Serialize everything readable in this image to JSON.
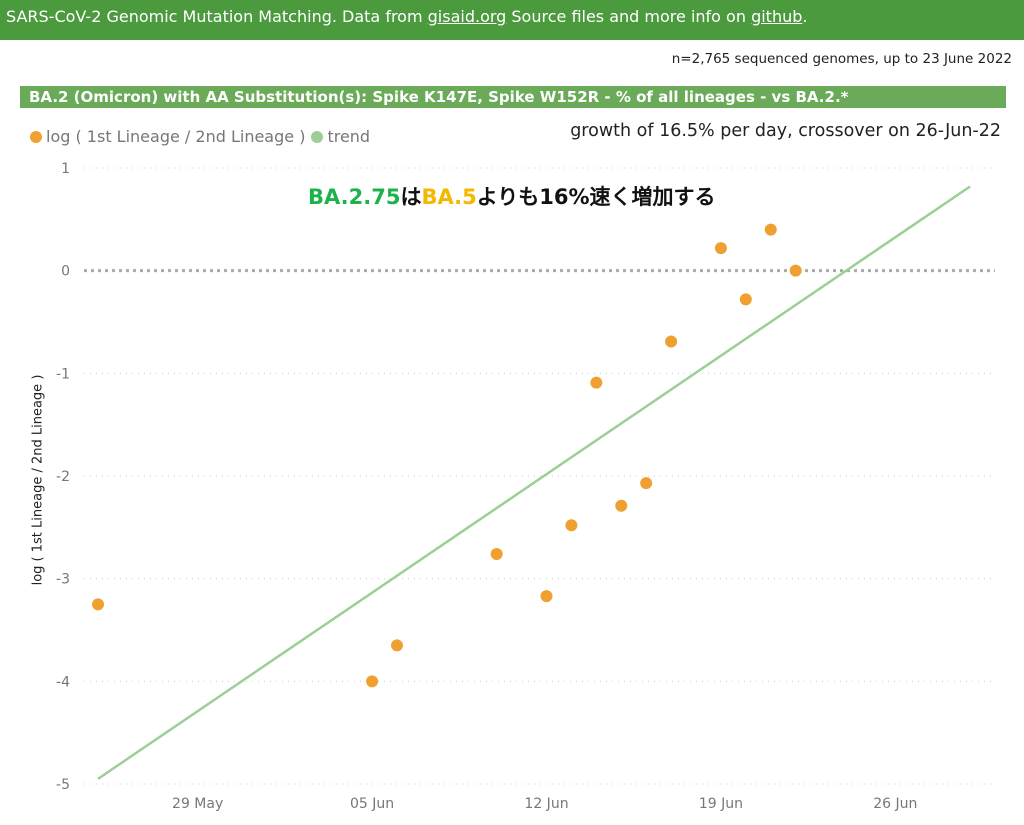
{
  "header": {
    "prefix": "SARS-CoV-2 Genomic Mutation Matching. Data from ",
    "source_link": "gisaid.org",
    "middle": " Source files and more info on ",
    "repo_link": "github",
    "suffix": "."
  },
  "sample_note": "n=2,765 sequenced genomes, up to 23 June 2022",
  "panel_title": "BA.2 (Omicron) with AA Substitution(s): Spike K147E, Spike W152R - % of all lineages -  vs BA.2.*",
  "growth_note": "growth of 16.5% per day, crossover on 26-Jun-22",
  "annotation": {
    "part1": "BA.2.75",
    "part2": "は",
    "part3": "BA.5",
    "part4": "よりも16%速く増加する",
    "colors": [
      "#1db34c",
      "#111111",
      "#f5b800",
      "#111111"
    ]
  },
  "colors": {
    "header_bg": "#4b9a3e",
    "title_bg": "#6aaa58",
    "points": "#f0a030",
    "trend": "#9ccf95",
    "zero_line": "#aaaaaa",
    "grid": "#cccccc"
  },
  "chart_data": {
    "type": "scatter",
    "ylabel": "log ( 1st Lineage / 2nd Lineage )",
    "xlabel": "",
    "ylim": [
      -5,
      1
    ],
    "yticks": [
      1,
      0,
      -1,
      -2,
      -3,
      -4,
      -5
    ],
    "xlim": [
      "2022-05-25",
      "2022-06-30"
    ],
    "xticks": [
      {
        "date": "2022-05-29",
        "label": "29 May"
      },
      {
        "date": "2022-06-05",
        "label": "05 Jun"
      },
      {
        "date": "2022-06-12",
        "label": "12 Jun"
      },
      {
        "date": "2022-06-19",
        "label": "19 Jun"
      },
      {
        "date": "2022-06-26",
        "label": "26 Jun"
      }
    ],
    "grid": true,
    "legend": "top-left",
    "series": [
      {
        "name": "log ( 1st Lineage / 2nd Lineage )",
        "kind": "points",
        "color": "#f0a030",
        "points": [
          {
            "x": "2022-05-25",
            "y": -3.25
          },
          {
            "x": "2022-06-05",
            "y": -4.0
          },
          {
            "x": "2022-06-06",
            "y": -3.65
          },
          {
            "x": "2022-06-10",
            "y": -2.76
          },
          {
            "x": "2022-06-12",
            "y": -3.17
          },
          {
            "x": "2022-06-13",
            "y": -2.48
          },
          {
            "x": "2022-06-14",
            "y": -1.09
          },
          {
            "x": "2022-06-15",
            "y": -2.29
          },
          {
            "x": "2022-06-16",
            "y": -2.07
          },
          {
            "x": "2022-06-17",
            "y": -0.69
          },
          {
            "x": "2022-06-19",
            "y": 0.22
          },
          {
            "x": "2022-06-20",
            "y": -0.28
          },
          {
            "x": "2022-06-21",
            "y": 0.4
          },
          {
            "x": "2022-06-22",
            "y": 0.0
          }
        ]
      },
      {
        "name": "trend",
        "kind": "line",
        "color": "#9ccf95",
        "points": [
          {
            "x": "2022-05-25",
            "y": -4.95
          },
          {
            "x": "2022-06-29",
            "y": 0.82
          }
        ]
      }
    ]
  }
}
